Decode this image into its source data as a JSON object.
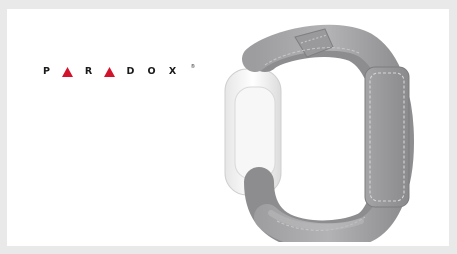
{
  "brand": {
    "letters": [
      "P",
      "A",
      "R",
      "A",
      "D",
      "O",
      "X"
    ],
    "registered_mark": "®",
    "accent_color": "#d3122b",
    "text_color": "#1a1a1a"
  },
  "product": {
    "icon": "wrist-panic-button-icon",
    "strap_color": "#a9a9ab",
    "body_color": "#f4f4f4"
  }
}
